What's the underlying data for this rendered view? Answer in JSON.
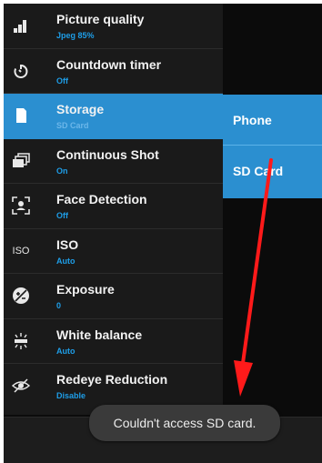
{
  "menu": {
    "items": [
      {
        "icon": "picture-quality-icon",
        "title": "Picture quality",
        "value": "Jpeg 85%"
      },
      {
        "icon": "countdown-timer-icon",
        "title": "Countdown timer",
        "value": "Off"
      },
      {
        "icon": "storage-card-icon",
        "title": "Storage",
        "value": "SD Card",
        "active": true
      },
      {
        "icon": "continuous-shot-icon",
        "title": "Continuous Shot",
        "value": "On"
      },
      {
        "icon": "face-detection-icon",
        "title": "Face Detection",
        "value": "Off"
      },
      {
        "icon": "iso-icon",
        "title": "ISO",
        "value": "Auto",
        "icon_text": "ISO"
      },
      {
        "icon": "exposure-icon",
        "title": "Exposure",
        "value": "0"
      },
      {
        "icon": "white-balance-icon",
        "title": "White balance",
        "value": "Auto"
      },
      {
        "icon": "redeye-icon",
        "title": "Redeye Reduction",
        "value": "Disable"
      }
    ]
  },
  "storage_submenu": {
    "options": [
      "Phone",
      "SD Card"
    ],
    "selected": "SD Card"
  },
  "toast": {
    "message": "Couldn't access SD card."
  },
  "colors": {
    "accent": "#2b8fd0",
    "value_text": "#1e9ee8",
    "annotation_arrow": "#ff1a1a"
  }
}
